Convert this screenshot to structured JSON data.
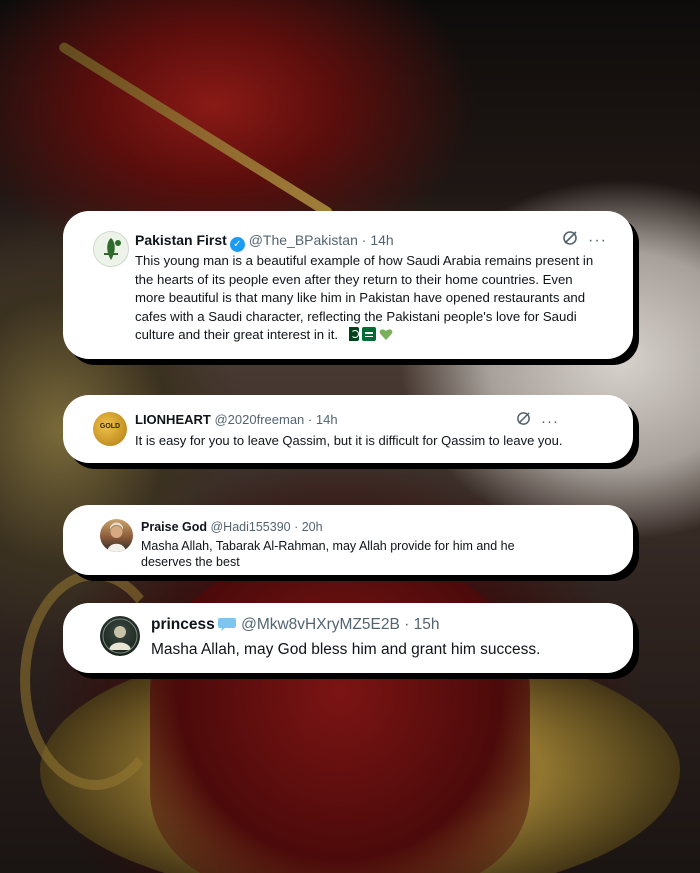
{
  "tweets": [
    {
      "name": "Pakistan First",
      "handle": "@The_BPakistan",
      "time": "14h",
      "text": "This young man is a beautiful example of how Saudi Arabia remains present in the hearts of its people even after they return to their home countries. Even more beautiful is that many like him in Pakistan have opened restaurants and cafes with a Saudi character, reflecting the Pakistani people's love for Saudi culture and their great interest in it.",
      "verified": true,
      "emoji": [
        "pakistan-flag-icon",
        "saudi-flag-icon",
        "green-heart-icon"
      ]
    },
    {
      "name": "LIONHEART",
      "handle": "@2020freeman",
      "time": "14h",
      "text": "It is easy for you to leave Qassim, but it is difficult for Qassim to leave you.",
      "avatar_text": "GOLD"
    },
    {
      "name": "Praise God",
      "handle": "@Hadi155390",
      "time": "20h",
      "text": "Masha Allah, Tabarak Al-Rahman, may Allah provide for him and he deserves the best"
    },
    {
      "name": "princess",
      "handle": "@Mkw8vHXryMZ5E2B",
      "time": "15h",
      "text": "Masha Allah, may God bless him and grant him success."
    }
  ],
  "separator": "·",
  "colors": {
    "accent": "#1d9bf0",
    "text": "#0f1419",
    "secondary": "#536471",
    "card_shadow": "#000000"
  }
}
